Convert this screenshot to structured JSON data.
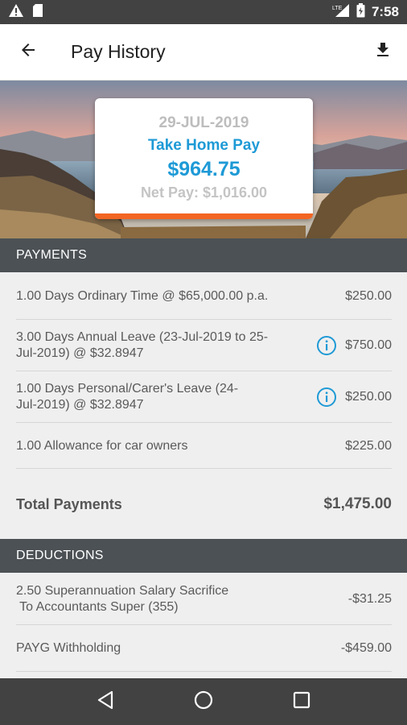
{
  "status_bar": {
    "time": "7:58",
    "network": "LTE",
    "icons": [
      "warning-icon",
      "sd-card-icon",
      "signal-icon",
      "battery-icon"
    ]
  },
  "app_bar": {
    "title": "Pay History",
    "back_icon": "arrow-left-icon",
    "download_icon": "download-icon"
  },
  "pay_card": {
    "date": "29-JUL-2019",
    "label": "Take Home Pay",
    "amount": "$964.75",
    "net_pay": "Net Pay: $1,016.00",
    "accent_color": "#f26522",
    "brand_color": "#1e9ad6"
  },
  "payments": {
    "header": "PAYMENTS",
    "items": [
      {
        "line1": "1.00 Days Ordinary Time @ $65,000.00 p.a.",
        "line2": "",
        "amount": "$250.00",
        "info": false
      },
      {
        "line1": "3.00 Days Annual Leave (23-Jul-2019 to 25-",
        "line2": "Jul-2019) @ $32.8947",
        "amount": "$750.00",
        "info": true
      },
      {
        "line1": "1.00 Days Personal/Carer's Leave (24-",
        "line2": "Jul-2019) @ $32.8947",
        "amount": "$250.00",
        "info": true
      },
      {
        "line1": "1.00 Allowance for car owners",
        "line2": "",
        "amount": "$225.00",
        "info": false
      }
    ],
    "total_label": "Total Payments",
    "total_amount": "$1,475.00"
  },
  "deductions": {
    "header": "DEDUCTIONS",
    "items": [
      {
        "line1": "2.50 Superannuation Salary Sacrifice",
        "line2": " To Accountants Super (355)",
        "amount": "-$31.25"
      },
      {
        "line1": "PAYG Withholding",
        "line2": "",
        "amount": "-$459.00"
      }
    ]
  },
  "nav_bar": {
    "buttons": [
      "back-triangle-icon",
      "home-circle-icon",
      "recents-square-icon"
    ]
  }
}
